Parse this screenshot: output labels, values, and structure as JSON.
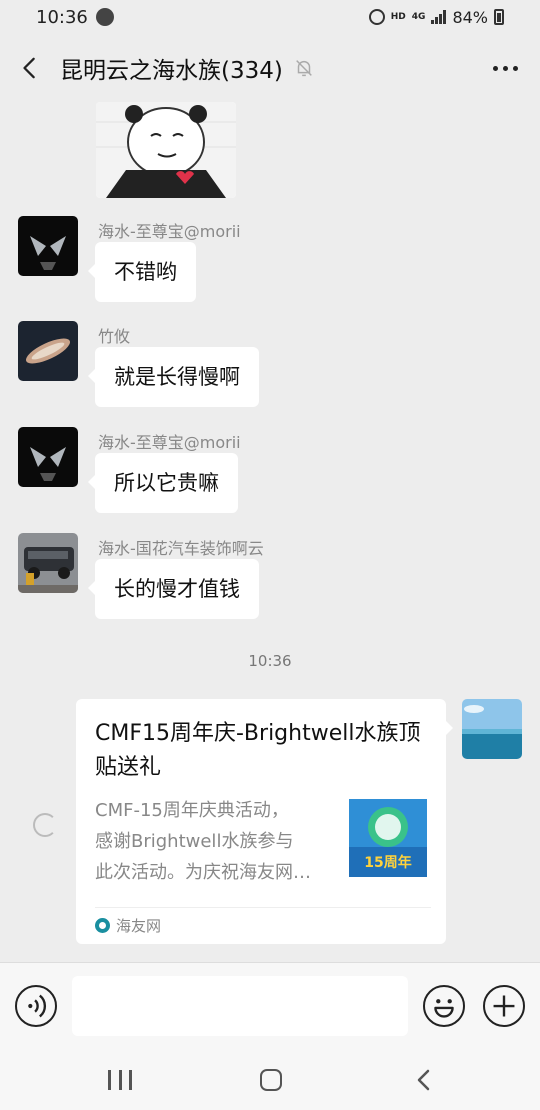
{
  "status_bar": {
    "time": "10:36",
    "hd": "HD",
    "network": "4G",
    "battery": "84%"
  },
  "header": {
    "title": "昆明云之海水族(334)",
    "icons": [
      "back-arrow-icon",
      "mute-bell-icon",
      "more-dots-icon"
    ]
  },
  "messages": [
    {
      "sender": "海水-至尊宝@morii",
      "text": "不错哟",
      "avatar": "iron-man-dark"
    },
    {
      "sender": "竹攸",
      "text": "就是长得慢啊",
      "avatar": "coral-dark"
    },
    {
      "sender": "海水-至尊宝@morii",
      "text": "所以它贵嘛",
      "avatar": "iron-man-dark"
    },
    {
      "sender": "海水-国花汽车装饰啊云",
      "text": "长的慢才值钱",
      "avatar": "car-photo"
    }
  ],
  "timestamp": "10:36",
  "link_card": {
    "title": "CMF15周年庆-Brightwell水族顶贴送礼",
    "description": "CMF-15周年庆典活动，\n感谢Brightwell水族参与\n此次活动。为庆祝海友网…",
    "source": "海友网",
    "thumb_text": "15周年"
  },
  "input": {
    "placeholder": "",
    "icons": [
      "voice-icon",
      "emoji-icon",
      "plus-icon"
    ]
  },
  "colors": {
    "background": "#ededed",
    "bubble": "#ffffff",
    "meta_text": "#888888"
  }
}
